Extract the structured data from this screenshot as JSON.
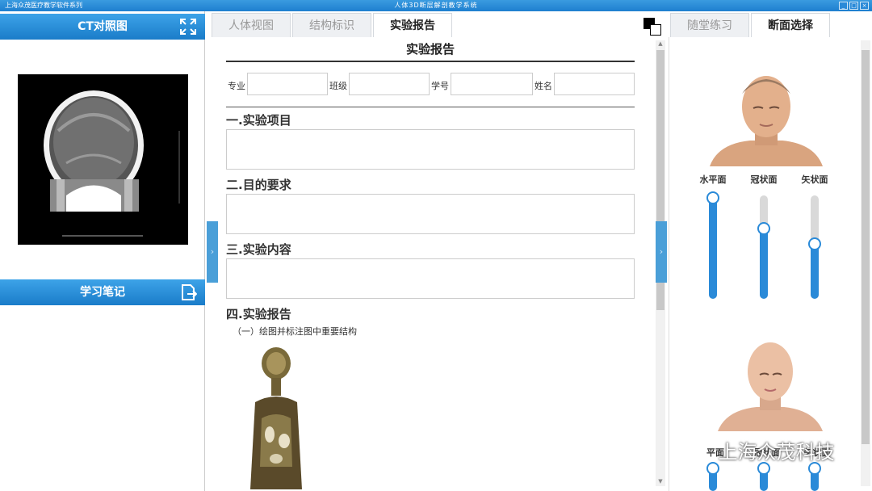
{
  "titlebar": {
    "left_title": "上海众茂医疗教学软件系列",
    "center_title": "人体3D断层解剖教学系统",
    "min": "_",
    "max": "□",
    "close": "×"
  },
  "left_panel": {
    "ct_title": "CT对照图",
    "notes_title": "学习笔记"
  },
  "main_tabs": [
    "人体视图",
    "结构标识",
    "实验报告"
  ],
  "active_main_tab": "实验报告",
  "right_tabs": [
    "随堂练习",
    "断面选择"
  ],
  "active_right_tab": "断面选择",
  "report": {
    "title": "实验报告",
    "fields": [
      {
        "label": "专业",
        "value": ""
      },
      {
        "label": "班级",
        "value": ""
      },
      {
        "label": "学号",
        "value": ""
      },
      {
        "label": "姓名",
        "value": ""
      }
    ],
    "sections": [
      {
        "heading": "一.实验项目",
        "content": ""
      },
      {
        "heading": "二.目的要求",
        "content": ""
      },
      {
        "heading": "三.实验内容",
        "content": ""
      }
    ],
    "section4_heading": "四.实验报告",
    "section4_sub": "（一）绘图并标注图中重要结构"
  },
  "sliders": [
    {
      "label": "水平面",
      "level": 0.98
    },
    {
      "label": "冠状面",
      "level": 0.68
    },
    {
      "label": "矢状面",
      "level": 0.53
    }
  ],
  "sliders_lower_labels": [
    "平面",
    "冠状面",
    "矢状面"
  ],
  "watermark": "上海众茂科技",
  "colors": {
    "accent": "#2a8ad8",
    "header_blue": "#1a7cc9"
  }
}
